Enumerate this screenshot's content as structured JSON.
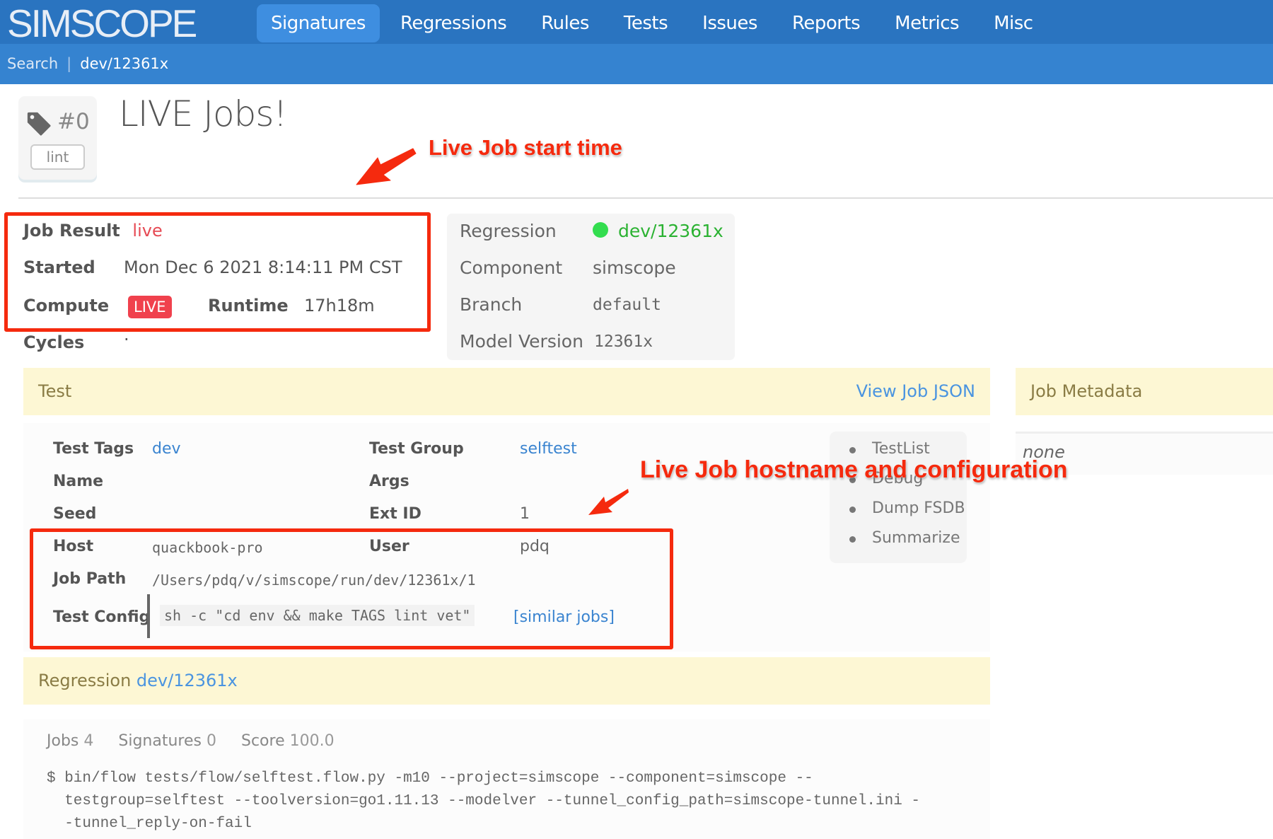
{
  "app": {
    "logo": "SIMSCOPE"
  },
  "nav": {
    "items": [
      {
        "label": "Signatures",
        "active": true
      },
      {
        "label": "Regressions",
        "active": false
      },
      {
        "label": "Rules",
        "active": false
      },
      {
        "label": "Tests",
        "active": false
      },
      {
        "label": "Issues",
        "active": false
      },
      {
        "label": "Reports",
        "active": false
      },
      {
        "label": "Metrics",
        "active": false
      },
      {
        "label": "Misc",
        "active": false
      }
    ]
  },
  "breadcrumb": {
    "search": "Search",
    "separator": "|",
    "current": "dev/12361x"
  },
  "tag_card": {
    "icon": "tag-icon",
    "number": "#0",
    "tag": "lint"
  },
  "page": {
    "title": "LIVE Jobs!"
  },
  "annotations": {
    "start_time": "Live Job start time",
    "host_config": "Live Job hostname and configuration"
  },
  "job_summary": {
    "job_result_label": "Job Result",
    "job_result_value": "live",
    "started_label": "Started",
    "started_value": "Mon Dec 6 2021 8:14:11 PM CST",
    "compute_label": "Compute",
    "compute_badge": "LIVE",
    "runtime_label": "Runtime",
    "runtime_value": "17h18m",
    "cycles_label": "Cycles",
    "cycles_value": "·"
  },
  "regression_panel": {
    "regression_label": "Regression",
    "regression_value": "dev/12361x",
    "regression_status_color": "#33dd4f",
    "component_label": "Component",
    "component_value": "simscope",
    "branch_label": "Branch",
    "branch_value": "default",
    "model_version_label": "Model Version",
    "model_version_value": "12361x"
  },
  "test_section": {
    "header": "Test",
    "view_json": "View Job JSON",
    "fields": {
      "test_tags_label": "Test Tags",
      "test_tags_value": "dev",
      "test_group_label": "Test Group",
      "test_group_value": "selftest",
      "name_label": "Name",
      "name_value": "",
      "args_label": "Args",
      "args_value": "",
      "seed_label": "Seed",
      "seed_value": "",
      "ext_id_label": "Ext ID",
      "ext_id_value": "1",
      "host_label": "Host",
      "host_value": "quackbook-pro",
      "user_label": "User",
      "user_value": "pdq",
      "job_path_label": "Job Path",
      "job_path_value": "/Users/pdq/v/simscope/run/dev/12361x/1",
      "test_config_label": "Test Config",
      "test_config_value": "sh -c \"cd env && make TAGS lint vet\"",
      "similar_jobs": "[similar jobs]"
    },
    "actions": [
      "TestList",
      "Debug",
      "Dump FSDB",
      "Summarize"
    ]
  },
  "metadata_section": {
    "header": "Job Metadata",
    "value": "none"
  },
  "regression_section": {
    "header_label": "Regression",
    "header_link": "dev/12361x",
    "stats": [
      {
        "label": "Jobs",
        "value": "4"
      },
      {
        "label": "Signatures",
        "value": "0"
      },
      {
        "label": "Score",
        "value": "100.0"
      }
    ],
    "command_lines": [
      "$ bin/flow tests/flow/selftest.flow.py -m10 --project=simscope --component=simscope --",
      "  testgroup=selftest --toolversion=go1.11.13 --modelver --tunnel_config_path=simscope-tunnel.ini -",
      "  -tunnel_reply-on-fail"
    ]
  },
  "colors": {
    "nav_bg": "#2a74c0",
    "subbar_bg": "#3583d0",
    "active_nav": "#3e8ee0",
    "annotation_red": "#f52a0e",
    "live_red": "#f0414d",
    "header_yellow": "#fdf7d4",
    "link_blue": "#2a74c0"
  }
}
